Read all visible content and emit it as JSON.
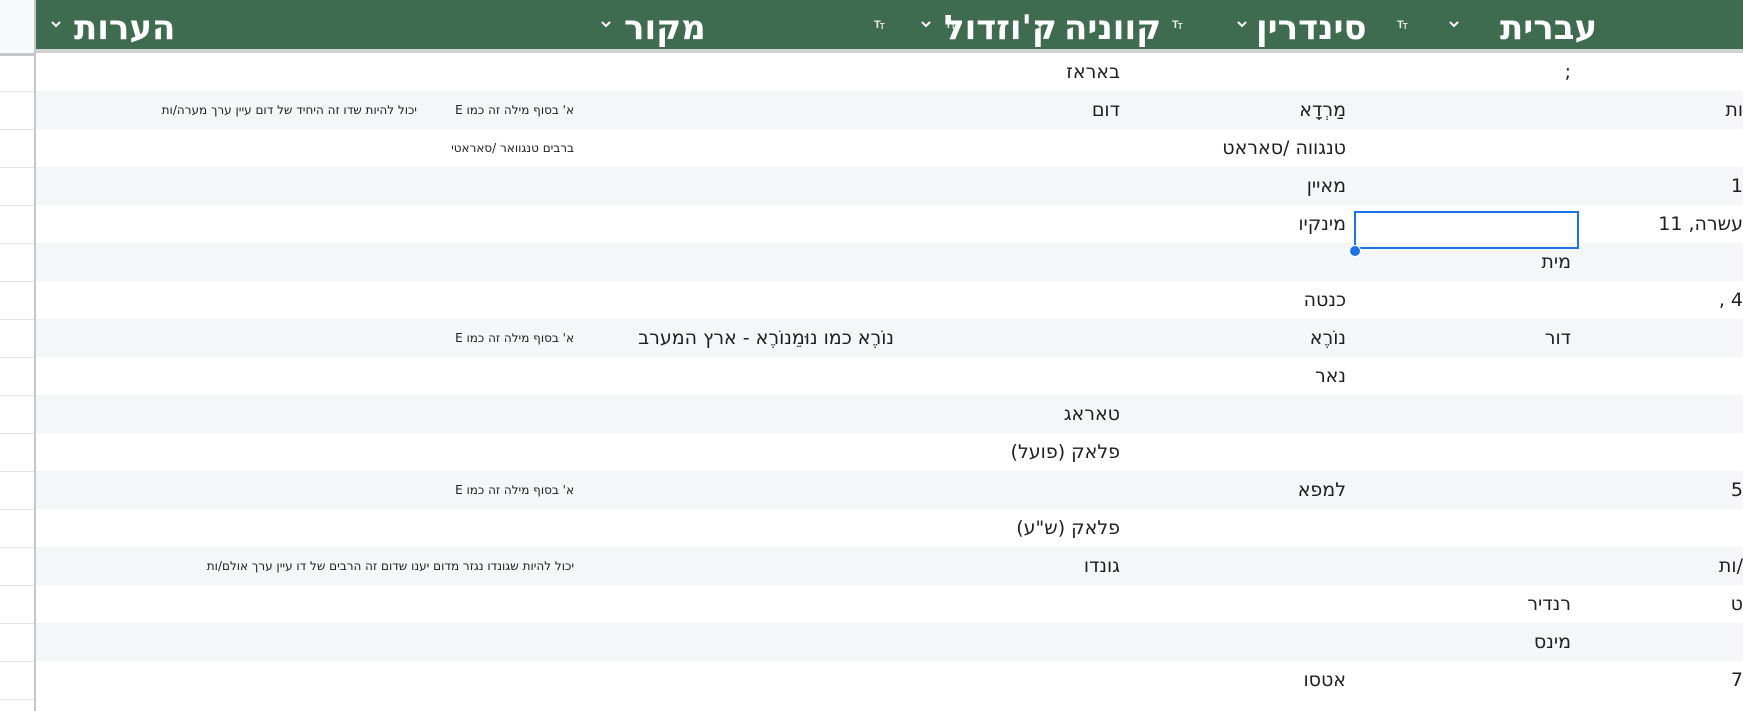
{
  "colors": {
    "header_bg": "#3f6b50",
    "header_text": "#ffffff",
    "row_alt": "#f4f6f7",
    "selection": "#1a73e8"
  },
  "header": {
    "col_english_title": "עברית",
    "col_sindarin_title": "סינדרין",
    "col_quenya_title": "קווניה",
    "col_khuzdul_title": "ק'וזדול",
    "col_source_title": "מקור",
    "col_notes_title": "הערות",
    "type_icon": "Tт",
    "menu_icon": "chevron-down-icon"
  },
  "rows": [
    {
      "hebrew": "",
      "sindarin": ";",
      "quenya": "",
      "khuzdul": "באראז",
      "source": "",
      "notes_a": "",
      "notes_b": ""
    },
    {
      "hebrew": "ות",
      "sindarin": "",
      "quenya": "מַרְדָא",
      "khuzdul": "דום",
      "source": "",
      "notes_a": "א' בסוף מילה זה כמו E",
      "notes_b": "יכול להיות שדו זה היחיד של דום עיין ערך מערה/ות"
    },
    {
      "hebrew": "",
      "sindarin": "",
      "quenya": "טנגווה /סאראט",
      "khuzdul": "",
      "source": "",
      "notes_a": "ברבים טנגוואר /סאראטי",
      "notes_b": ""
    },
    {
      "hebrew": "1",
      "sindarin": "",
      "quenya": "מאיין",
      "khuzdul": "",
      "source": "",
      "notes_a": "",
      "notes_b": ""
    },
    {
      "hebrew": "עשרה, 11",
      "sindarin": "",
      "quenya": "מינקיו",
      "khuzdul": "",
      "source": "",
      "notes_a": "",
      "notes_b": ""
    },
    {
      "hebrew": "",
      "sindarin": "מית",
      "quenya": "",
      "khuzdul": "",
      "source": "",
      "notes_a": "",
      "notes_b": ""
    },
    {
      "hebrew": "4 ,",
      "sindarin": "",
      "quenya": "כנטה",
      "khuzdul": "",
      "source": "",
      "notes_a": "",
      "notes_b": ""
    },
    {
      "hebrew": "",
      "sindarin": "דור",
      "quenya": "נוֹרֶא",
      "khuzdul": "",
      "source": "נוֹרֶא כמו נוּמֵנוֹרֶא - ארץ המערב",
      "notes_a": "א' בסוף מילה זה כמו E",
      "notes_b": ""
    },
    {
      "hebrew": "",
      "sindarin": "",
      "quenya": "נאר",
      "khuzdul": "",
      "source": "",
      "notes_a": "",
      "notes_b": ""
    },
    {
      "hebrew": "",
      "sindarin": "",
      "quenya": "",
      "khuzdul": "טאראג",
      "source": "",
      "notes_a": "",
      "notes_b": ""
    },
    {
      "hebrew": "",
      "sindarin": "",
      "quenya": "",
      "khuzdul": "פלאק (פועל)",
      "source": "",
      "notes_a": "",
      "notes_b": ""
    },
    {
      "hebrew": "5",
      "sindarin": "",
      "quenya": "למפא",
      "khuzdul": "",
      "source": "",
      "notes_a": "א' בסוף מילה זה כמו E",
      "notes_b": ""
    },
    {
      "hebrew": "",
      "sindarin": "",
      "quenya": "",
      "khuzdul": "פלאק (ש\"ע)",
      "source": "",
      "notes_a": "",
      "notes_b": ""
    },
    {
      "hebrew": "/ות",
      "sindarin": "",
      "quenya": "",
      "khuzdul": "גונדו",
      "source": "",
      "notes_a": "יכול להיות שגונדו נגזר מדום יענו שדום זה הרבים של דו עיין ערך אולם/ות",
      "notes_b": ""
    },
    {
      "hebrew": "ט",
      "sindarin": "רנדיר",
      "quenya": "",
      "khuzdul": "",
      "source": "",
      "notes_a": "",
      "notes_b": ""
    },
    {
      "hebrew": "",
      "sindarin": "מינס",
      "quenya": "",
      "khuzdul": "",
      "source": "",
      "notes_a": "",
      "notes_b": ""
    },
    {
      "hebrew": "7",
      "sindarin": "",
      "quenya": "אטסו",
      "khuzdul": "",
      "source": "",
      "notes_a": "",
      "notes_b": ""
    }
  ]
}
